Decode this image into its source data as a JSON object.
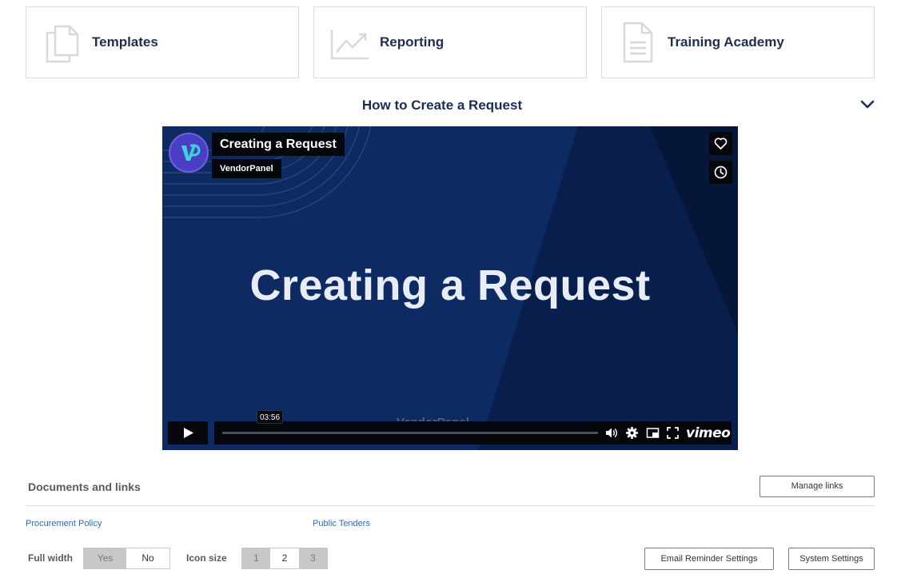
{
  "cards": [
    {
      "label": "Templates",
      "icon": "copy-documents-icon"
    },
    {
      "label": "Reporting",
      "icon": "trend-chart-icon"
    },
    {
      "label": "Training Academy",
      "icon": "document-icon"
    }
  ],
  "section": {
    "title": "How to Create a Request",
    "toggle_icon": "chevron-down-icon"
  },
  "video": {
    "title": "Creating a Request",
    "owner": "VendorPanel",
    "slide_text": "Creating a Request",
    "watermark": "VendorPanel",
    "time_tooltip": "03:56",
    "progress": 0,
    "player_brand": "vimeo",
    "colors": {
      "background": "#0e2a63",
      "avatar": "#4a3fc4"
    }
  },
  "documents": {
    "title": "Documents and links",
    "manage_label": "Manage links",
    "links": [
      "Procurement Policy",
      "Public Tenders"
    ]
  },
  "options": {
    "full_width_label": "Full width",
    "full_width_options": [
      "Yes",
      "No"
    ],
    "full_width_selected": "No",
    "icon_size_label": "Icon size",
    "icon_size_options": [
      "1",
      "2",
      "3"
    ],
    "icon_size_selected": "2",
    "email_reminder_label": "Email Reminder Settings",
    "system_settings_label": "System Settings"
  }
}
